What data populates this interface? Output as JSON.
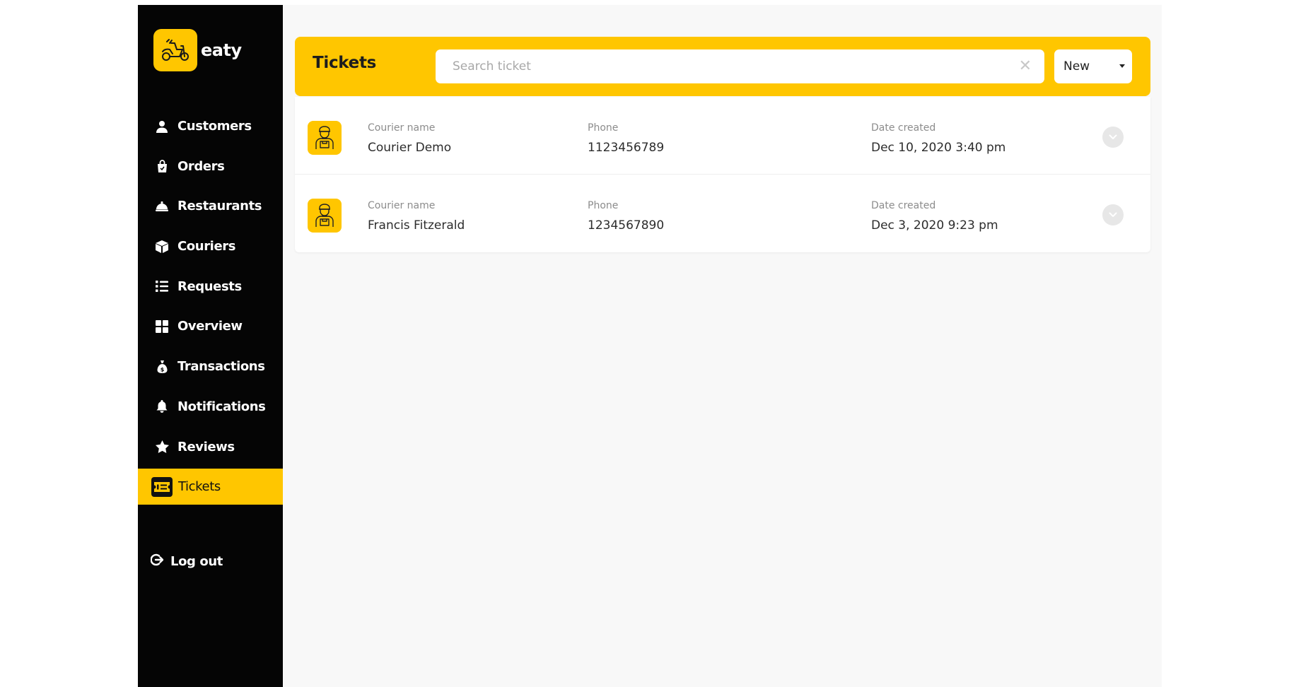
{
  "brand": {
    "name": "eaty",
    "logo_icon": "scooter-icon",
    "accent": "#ffc600"
  },
  "sidebar": {
    "items": [
      {
        "label": "Customers",
        "icon": "user-icon"
      },
      {
        "label": "Orders",
        "icon": "shopping-bag-icon"
      },
      {
        "label": "Restaurants",
        "icon": "cloche-icon"
      },
      {
        "label": "Couriers",
        "icon": "box-icon"
      },
      {
        "label": "Requests",
        "icon": "list-icon"
      },
      {
        "label": "Overview",
        "icon": "grid-icon"
      },
      {
        "label": "Transactions",
        "icon": "money-bag-icon"
      },
      {
        "label": "Notifications",
        "icon": "bell-icon"
      },
      {
        "label": "Reviews",
        "icon": "star-icon"
      },
      {
        "label": "Tickets",
        "icon": "ticket-icon",
        "active": true
      }
    ],
    "logout_label": "Log out"
  },
  "header": {
    "title": "Tickets",
    "search_placeholder": "Search ticket",
    "status_filter": "New"
  },
  "tickets": {
    "columns": {
      "name": "Courier name",
      "phone": "Phone",
      "date": "Date created"
    },
    "rows": [
      {
        "name": "Courier Demo",
        "phone": "1123456789",
        "date": "Dec 10, 2020 3:40 pm"
      },
      {
        "name": "Francis Fitzerald",
        "phone": "1234567890",
        "date": "Dec 3, 2020 9:23 pm"
      }
    ]
  }
}
